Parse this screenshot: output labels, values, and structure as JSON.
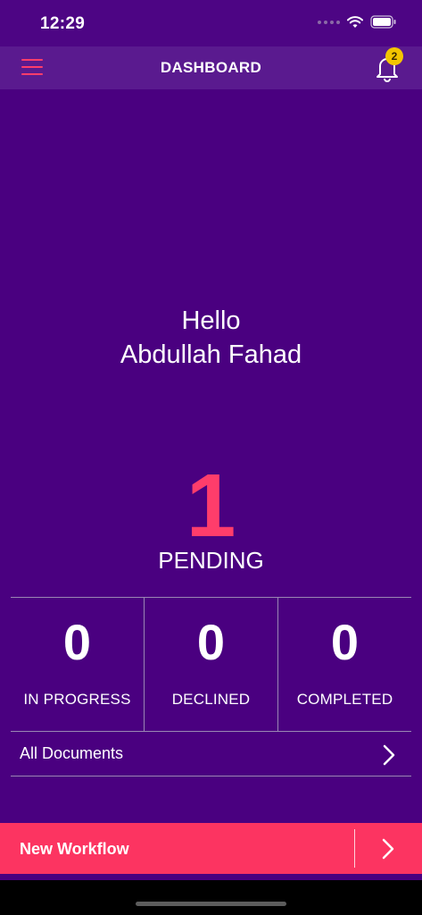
{
  "status_bar": {
    "time": "12:29"
  },
  "header": {
    "title": "DASHBOARD",
    "notification_count": "2"
  },
  "greeting": {
    "line1": "Hello",
    "name": "Abdullah Fahad"
  },
  "pending": {
    "count": "1",
    "label": "PENDING"
  },
  "stats": [
    {
      "value": "0",
      "label": "IN PROGRESS"
    },
    {
      "value": "0",
      "label": "DECLINED"
    },
    {
      "value": "0",
      "label": "COMPLETED"
    }
  ],
  "all_documents": {
    "label": "All Documents"
  },
  "cta": {
    "label": "New Workflow"
  },
  "icons": [
    "hamburger-menu-icon",
    "bell-icon",
    "wifi-icon",
    "battery-icon",
    "chevron-right-icon"
  ],
  "colors": {
    "background": "#4a0080",
    "accent": "#fc3461",
    "badge": "#f3c500"
  }
}
